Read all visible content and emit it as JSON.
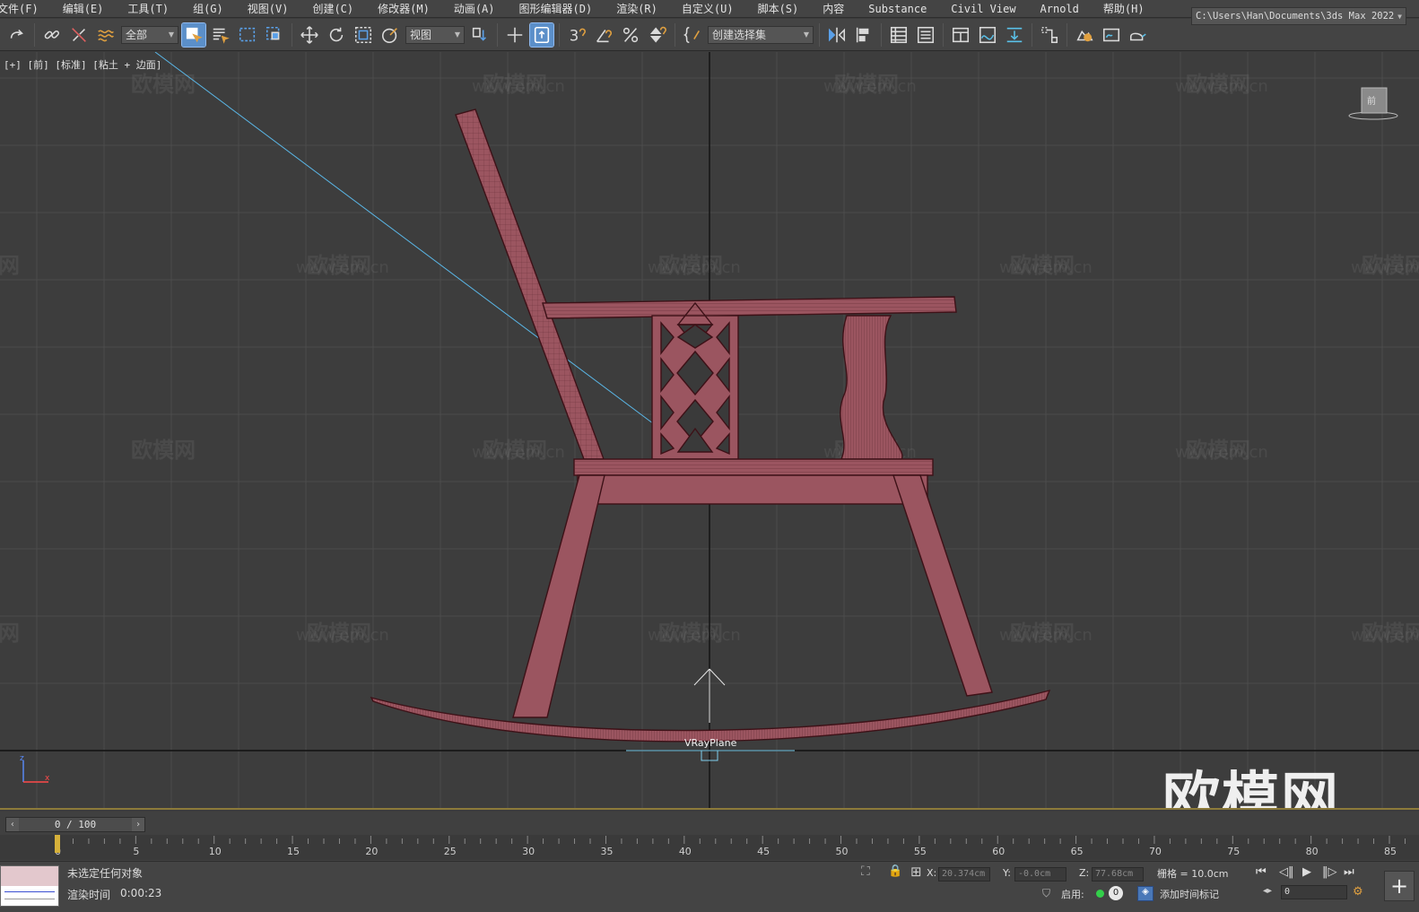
{
  "menu": [
    "文件(F)",
    "编辑(E)",
    "工具(T)",
    "组(G)",
    "视图(V)",
    "创建(C)",
    "修改器(M)",
    "动画(A)",
    "图形编辑器(D)",
    "渲染(R)",
    "自定义(U)",
    "脚本(S)",
    "内容",
    "Substance",
    "Civil View",
    "Arnold",
    "帮助(H)"
  ],
  "toolbar": {
    "filter_value": "全部",
    "coord_system": "视图",
    "snap_value": "3",
    "selection_set": "创建选择集",
    "project_path": "C:\\Users\\Han\\Documents\\3ds Max 2022"
  },
  "viewport": {
    "label": "[+] [前] [标准] [粘土 + 边面]",
    "object_label": "VRayPlane",
    "watermark_logo": "欧模网",
    "watermark_url": "www.om.cn",
    "watermark_partial": "om.cn",
    "axis_z": "z",
    "axis_x": "x",
    "viewcube": "前"
  },
  "timeline": {
    "slider": "0 / 100",
    "ticks": [
      "0",
      "5",
      "10",
      "15",
      "20",
      "25",
      "30",
      "35",
      "40",
      "45",
      "50",
      "55",
      "60",
      "65",
      "70",
      "75",
      "80",
      "85"
    ]
  },
  "status": {
    "selection": "未选定任何对象",
    "render_time_label": "渲染时间",
    "render_time": "0:00:23",
    "x_label": "X:",
    "x": "20.374cm",
    "y_label": "Y:",
    "y": "-0.0cm",
    "z_label": "Z:",
    "z": "77.68cm",
    "grid": "栅格 = 10.0cm",
    "enable_label": "启用:",
    "add_key_label": "添加时间标记",
    "frame": "0",
    "key_count": "0"
  },
  "colors": {
    "chair": "#9b5560",
    "chair_dark": "#4d1e24",
    "accent": "#5b8fc9",
    "grid": "#4b4b4b"
  }
}
